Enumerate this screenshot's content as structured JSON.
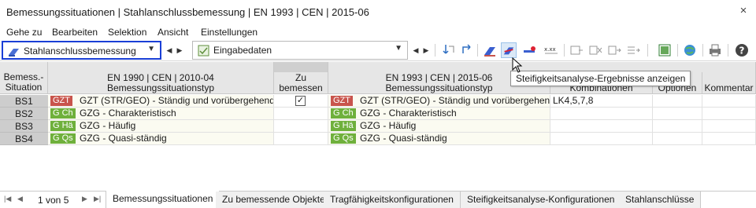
{
  "window": {
    "title": "Bemessungssituationen | Stahlanschlussbemessung | EN 1993 | CEN | 2015-06",
    "close_glyph": "×"
  },
  "menu": [
    "Gehe zu",
    "Bearbeiten",
    "Selektion",
    "Ansicht",
    "Einstellungen"
  ],
  "toolbar": {
    "module_select": "Stahlanschlussbemessung",
    "view_select": "Eingabedaten",
    "tooltip": "Steifigkeitsanalyse-Ergebnisse anzeigen",
    "accent_color": "#1a3fd6"
  },
  "table": {
    "header": {
      "situation": "Bemess.-\nSituation",
      "left_norm": "EN 1990 | CEN | 2010-04",
      "left_type": "Bemessungssituationstyp",
      "to_design": "Zu\nbemessen",
      "right_norm": "EN 1993 | CEN | 2015-06",
      "right_type": "Bemessungssituationstyp",
      "combos": "Kombinationen",
      "options": "Optionen",
      "comment": "Kommentar"
    },
    "rows": [
      {
        "id": "BS1",
        "left_badge": "GZT",
        "left_text": "GZT (STR/GEO) - Ständig und vorübergehend...",
        "checked": true,
        "right_badge": "GZT",
        "right_text": "GZT (STR/GEO) - Ständig und vorübergehend",
        "combos": "LK4,5,7,8",
        "badge_color": "red"
      },
      {
        "id": "BS2",
        "left_badge": "G Ch",
        "left_text": "GZG - Charakteristisch",
        "checked": false,
        "right_badge": "G Ch",
        "right_text": "GZG - Charakteristisch",
        "combos": "",
        "badge_color": "green"
      },
      {
        "id": "BS3",
        "left_badge": "G Hä",
        "left_text": "GZG - Häufig",
        "checked": false,
        "right_badge": "G Hä",
        "right_text": "GZG - Häufig",
        "combos": "",
        "badge_color": "green"
      },
      {
        "id": "BS4",
        "left_badge": "G Qs",
        "left_text": "GZG - Quasi-ständig",
        "checked": false,
        "right_badge": "G Qs",
        "right_text": "GZG - Quasi-ständig",
        "combos": "",
        "badge_color": "green"
      }
    ]
  },
  "bottom": {
    "page": "1 von 5",
    "tabs": [
      "Bemessungssituationen",
      "Zu bemessende Objekte",
      "Tragfähigkeitskonfigurationen",
      "Steifigkeitsanalyse-Konfigurationen",
      "Stahlanschlüsse"
    ]
  }
}
